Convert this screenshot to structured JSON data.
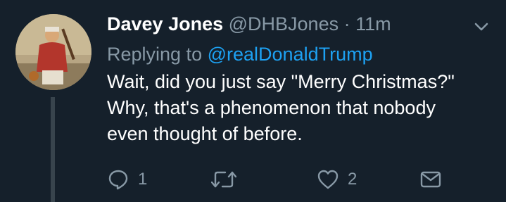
{
  "tweet": {
    "author_name": "Davey Jones",
    "author_handle": "@DHBJones",
    "separator": "·",
    "timestamp": "11m",
    "replying_prefix": "Replying to",
    "replying_to": "@realDonaldTrump",
    "text_lines": [
      "Wait, did you just say \"Merry Christmas?\"",
      "Why, that's a phenomenon that nobody",
      "even thought of before."
    ],
    "reply_count": "1",
    "retweet_count": "",
    "like_count": "2"
  },
  "icons": {
    "caret": "chevron-down-icon",
    "reply": "reply-icon",
    "retweet": "retweet-icon",
    "like": "heart-icon",
    "dm": "envelope-icon"
  },
  "colors": {
    "background": "#15202b",
    "primary_text": "#ffffff",
    "secondary_text": "#8899a6",
    "link": "#1da1f2",
    "thread_line": "#38444d"
  }
}
